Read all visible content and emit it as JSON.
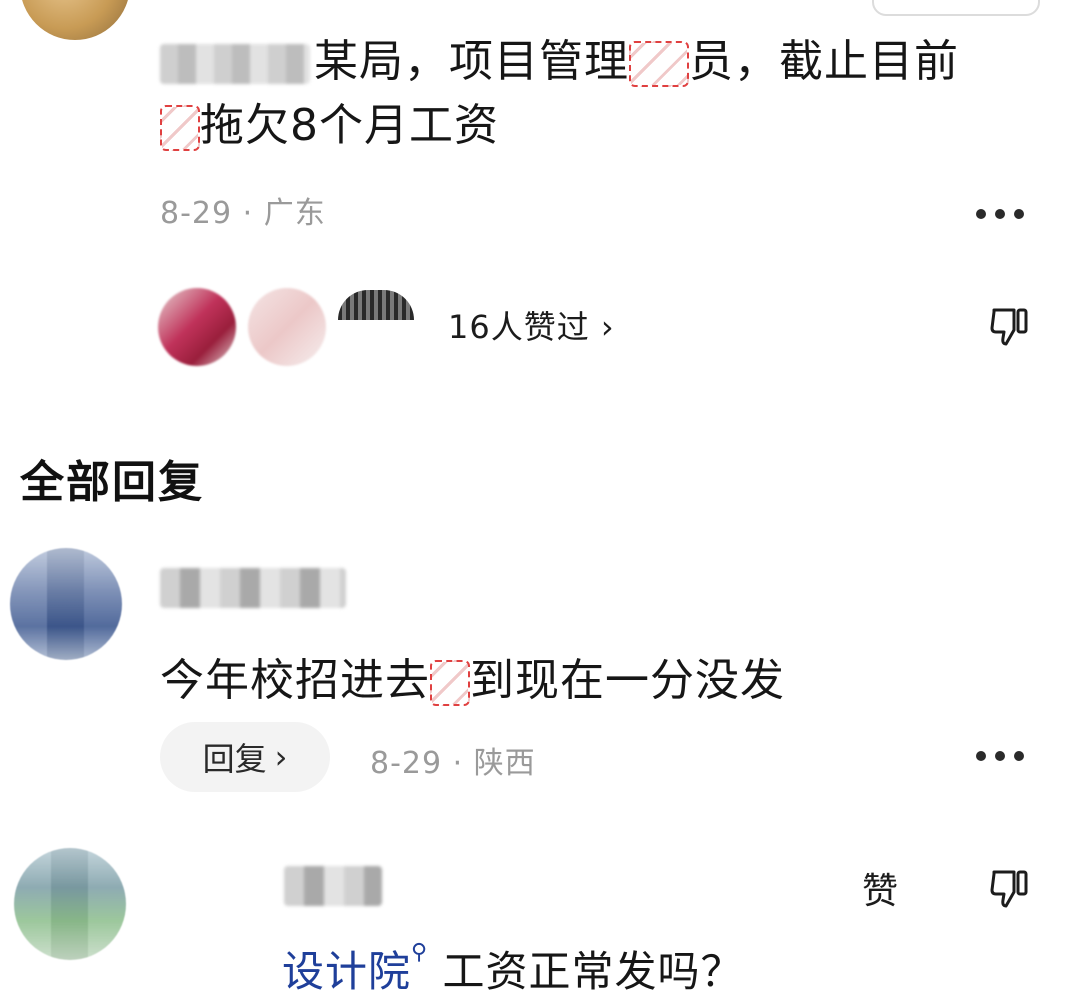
{
  "main_comment": {
    "text_part1": "某局，项目管理",
    "text_part2": "员，截止目前",
    "text_part3": "拖欠8个月工资",
    "date": "8-29",
    "separator": "·",
    "location": "广东",
    "likes_label": "16人赞过",
    "likes_chevron": "›"
  },
  "section": {
    "title": "全部回复"
  },
  "replies": [
    {
      "text_part1": "今年校招进去",
      "text_part2": "到现在一分没发",
      "reply_button": "回复",
      "reply_chevron": "›",
      "date": "8-29",
      "separator": "·",
      "location": "陕西"
    },
    {
      "zan_label": "赞",
      "text_link": "设计院",
      "search_glyph": "⚲",
      "text_rest": "工资正常发吗？"
    }
  ],
  "icons": {
    "more": "more-dots-icon",
    "dislike": "thumbs-down-icon"
  }
}
